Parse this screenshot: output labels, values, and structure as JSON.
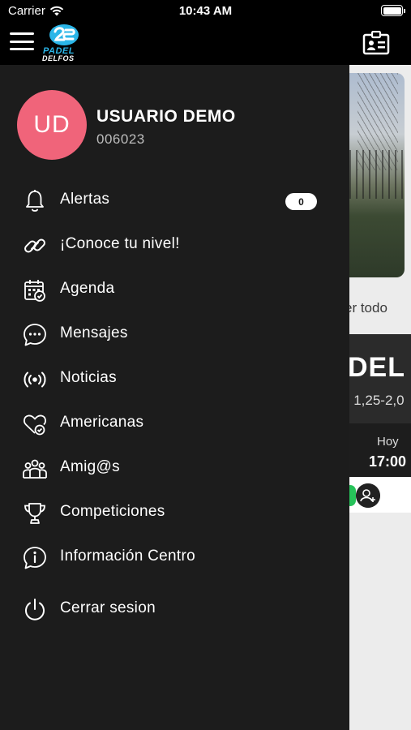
{
  "status_bar": {
    "carrier": "Carrier",
    "time": "10:43 AM",
    "battery_level": 1.0
  },
  "header": {
    "logo": {
      "line1": "PADEL",
      "line2": "DELFOS"
    },
    "icons": [
      "menu-icon",
      "id-card-icon"
    ]
  },
  "user": {
    "initials": "UD",
    "name": "USUARIO DEMO",
    "id": "006023"
  },
  "menu": [
    {
      "label": "Alertas",
      "icon": "bell-icon",
      "badge": "0"
    },
    {
      "label": "¡Conoce tu nivel!",
      "icon": "link-icon"
    },
    {
      "label": "Agenda",
      "icon": "calendar-check-icon"
    },
    {
      "label": "Mensajes",
      "icon": "chat-bubble-icon"
    },
    {
      "label": "Noticias",
      "icon": "broadcast-icon"
    },
    {
      "label": "Americanas",
      "icon": "heart-check-icon"
    },
    {
      "label": "Amig@s",
      "icon": "group-icon"
    },
    {
      "label": "Competiciones",
      "icon": "trophy-icon"
    },
    {
      "label": "Información Centro",
      "icon": "info-icon"
    },
    {
      "label": "Cerrar sesion",
      "icon": "power-icon"
    }
  ],
  "background": {
    "see_all": "er todo",
    "card_title": "DEL",
    "card_range": "s 1,25-2,0",
    "day": "Hoy",
    "time": "17:00"
  },
  "colors": {
    "avatar": "#f0647a",
    "drawer": "#1c1c1c",
    "accent_blue": "#2bb6e8"
  }
}
